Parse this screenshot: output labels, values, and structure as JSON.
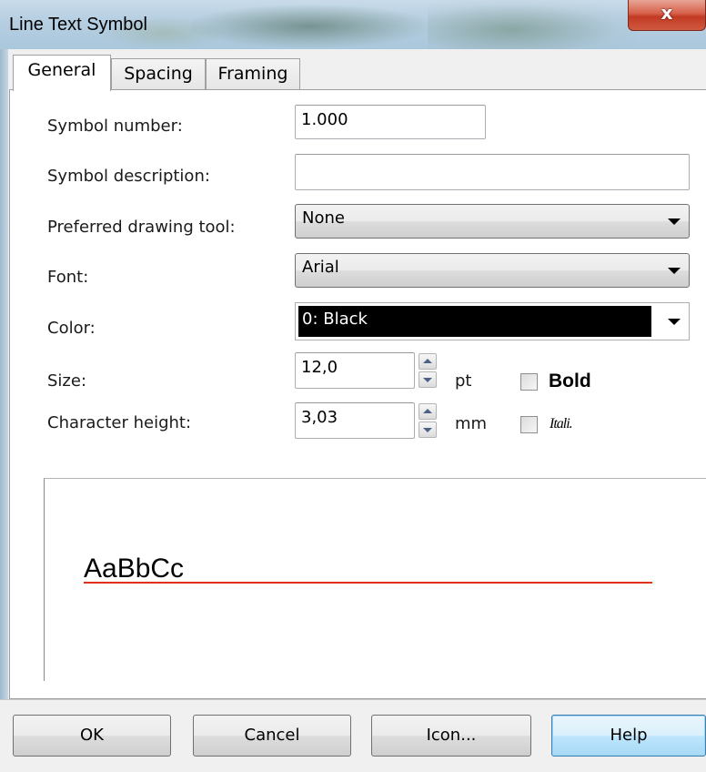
{
  "window": {
    "title": "Line Text Symbol",
    "close_glyph": "x"
  },
  "tabs": [
    {
      "label": "General",
      "active": true
    },
    {
      "label": "Spacing",
      "active": false
    },
    {
      "label": "Framing",
      "active": false
    }
  ],
  "form": {
    "symbol_number_label": "Symbol number:",
    "symbol_number_value": "1.000",
    "symbol_description_label": "Symbol description:",
    "symbol_description_value": "",
    "drawing_tool_label": "Preferred drawing tool:",
    "drawing_tool_value": "None",
    "font_label": "Font:",
    "font_value": "Arial",
    "color_label": "Color:",
    "color_value": "0: Black",
    "color_swatch": "#000000",
    "size_label": "Size:",
    "size_value": "12,0",
    "size_unit": "pt",
    "char_height_label": "Character height:",
    "char_height_value": "3,03",
    "char_height_unit": "mm",
    "bold_label": "Bold",
    "bold_checked": false,
    "italic_label": "Itali.",
    "italic_checked": false
  },
  "preview": {
    "sample_text": "AaBbCc",
    "line_color": "#e0301e"
  },
  "buttons": {
    "ok": "OK",
    "cancel": "Cancel",
    "icon": "Icon...",
    "help": "Help"
  }
}
